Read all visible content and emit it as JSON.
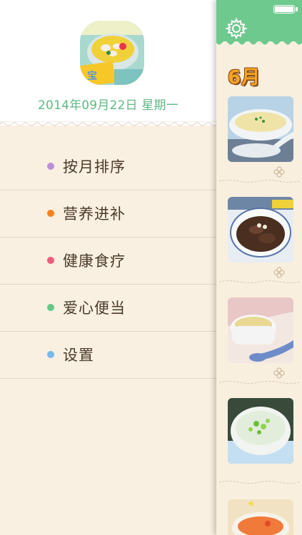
{
  "drawer": {
    "date_text": "2014年09月22日 星期一",
    "menu": [
      {
        "label": "按月排序",
        "dot_color": "#b990d8"
      },
      {
        "label": "营养进补",
        "dot_color": "#f5821f"
      },
      {
        "label": "健康食疗",
        "dot_color": "#ec5c7c"
      },
      {
        "label": "爱心便当",
        "dot_color": "#66c888"
      },
      {
        "label": "设置",
        "dot_color": "#79b8ee"
      }
    ]
  },
  "panel": {
    "month_badge": "6月",
    "header_color": "#6ec98f",
    "icons": [
      "gear-icon",
      "battery-icon",
      "flower-icon"
    ]
  },
  "colors": {
    "accent_green": "#5db983",
    "cream": "#f9f0e1",
    "text_dark": "#4a3a2a"
  }
}
